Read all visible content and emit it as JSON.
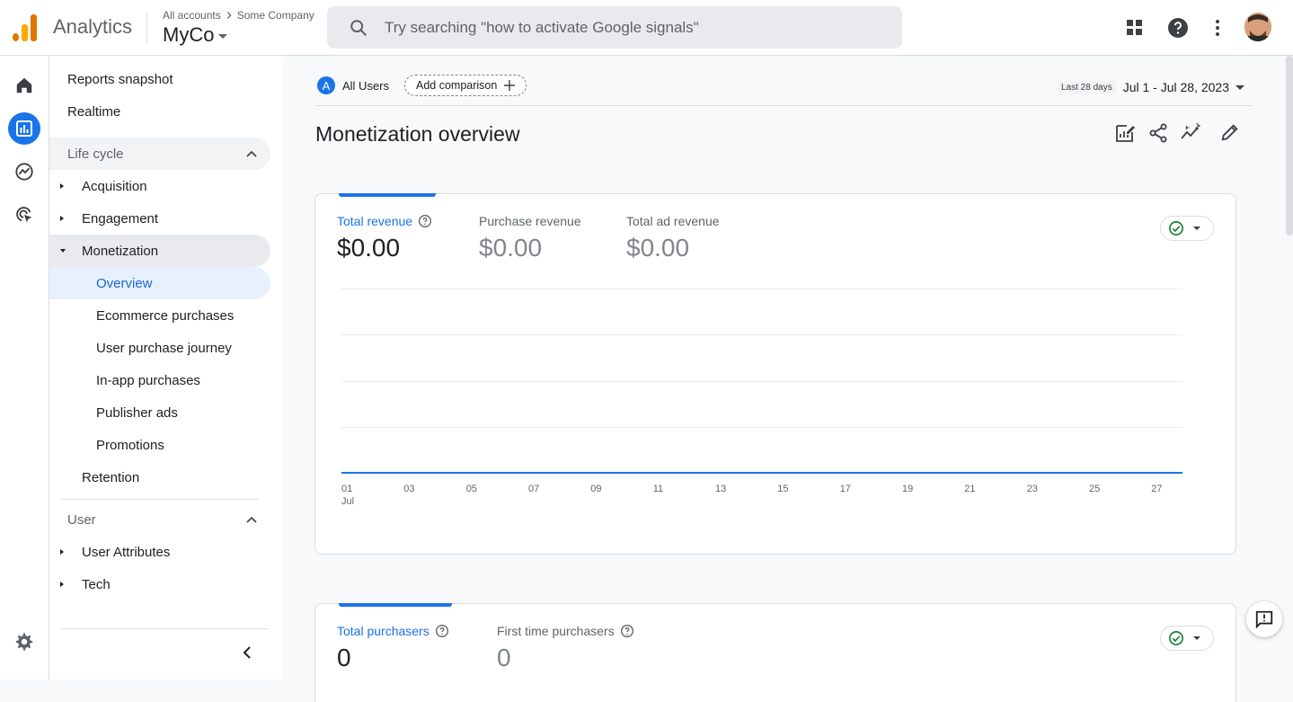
{
  "topbar": {
    "app_name": "Analytics",
    "breadcrumb_account": "All accounts",
    "breadcrumb_property": "Some Company",
    "property_name": "MyCo",
    "search_placeholder": "Try searching \"how to activate Google signals\"",
    "icons": [
      "apps-grid-icon",
      "help-icon",
      "more-vert-icon",
      "avatar"
    ]
  },
  "rail": {
    "items": [
      "home-icon",
      "reports-icon",
      "explore-icon",
      "advertising-icon"
    ],
    "bottom": "settings-icon"
  },
  "nav": {
    "reports_snapshot": "Reports snapshot",
    "realtime": "Realtime",
    "lifecycle_header": "Life cycle",
    "acquisition": "Acquisition",
    "engagement": "Engagement",
    "monetization": "Monetization",
    "sub": [
      "Overview",
      "Ecommerce purchases",
      "User purchase journey",
      "In-app purchases",
      "Publisher ads",
      "Promotions"
    ],
    "retention": "Retention",
    "user_header": "User",
    "user_attributes": "User Attributes",
    "tech": "Tech"
  },
  "main": {
    "segment_letter": "A",
    "segment_label": "All Users",
    "add_comparison": "Add comparison",
    "date_tag": "Last 28 days",
    "date_range": "Jul 1 - Jul 28, 2023",
    "title": "Monetization overview"
  },
  "card1": {
    "metrics": [
      {
        "label": "Total revenue",
        "value": "$0.00"
      },
      {
        "label": "Purchase revenue",
        "value": "$0.00"
      },
      {
        "label": "Total ad revenue",
        "value": "$0.00"
      }
    ],
    "x_ticks": [
      "01",
      "03",
      "05",
      "07",
      "09",
      "11",
      "13",
      "15",
      "17",
      "19",
      "21",
      "23",
      "25",
      "27"
    ],
    "x_month": "Jul"
  },
  "card2": {
    "metrics": [
      {
        "label": "Total purchasers",
        "value": "0"
      },
      {
        "label": "First time purchasers",
        "value": "0"
      }
    ]
  },
  "chart_data": {
    "type": "line",
    "x": [
      "01",
      "02",
      "03",
      "04",
      "05",
      "06",
      "07",
      "08",
      "09",
      "10",
      "11",
      "12",
      "13",
      "14",
      "15",
      "16",
      "17",
      "18",
      "19",
      "20",
      "21",
      "22",
      "23",
      "24",
      "25",
      "26",
      "27",
      "28"
    ],
    "series": [
      {
        "name": "Total revenue",
        "values": [
          0,
          0,
          0,
          0,
          0,
          0,
          0,
          0,
          0,
          0,
          0,
          0,
          0,
          0,
          0,
          0,
          0,
          0,
          0,
          0,
          0,
          0,
          0,
          0,
          0,
          0,
          0,
          0
        ]
      }
    ],
    "grid": true
  },
  "colors": {
    "accent": "#1a73e8",
    "logo_orange": "#f9ab00",
    "logo_dark": "#e37400",
    "check_green": "#188038"
  }
}
